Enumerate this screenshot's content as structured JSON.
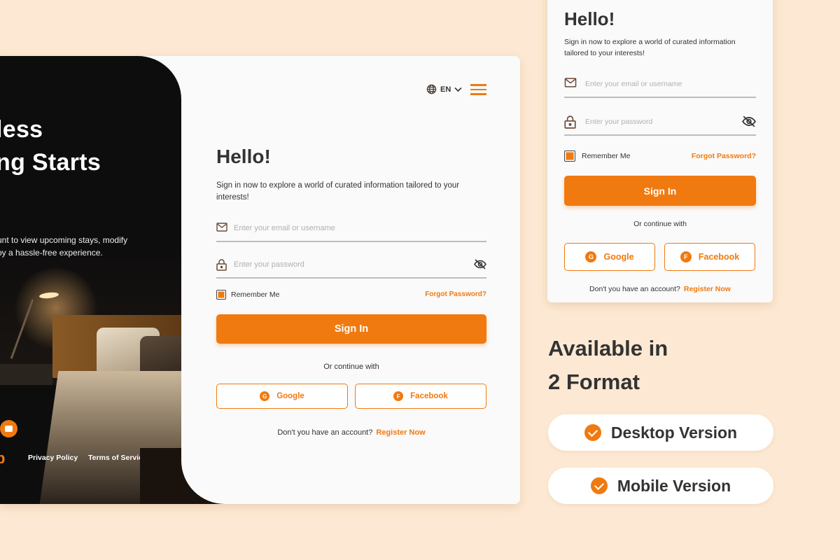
{
  "hero": {
    "title_line1": "less",
    "title_line2": "ng Starts",
    "desc_line1": "unt to view upcoming stays, modify",
    "desc_line2": "oy a hassle-free experience.",
    "logo_fragment": "b",
    "privacy": "Privacy Policy",
    "terms": "Terms of Service"
  },
  "header": {
    "language": "EN"
  },
  "login": {
    "title": "Hello!",
    "subtitle": "Sign in now to explore a world of curated information tailored to your interests!",
    "email_placeholder": "Enter your email or username",
    "password_placeholder": "Enter your password",
    "remember": "Remember Me",
    "remember_checked": true,
    "forgot": "Forgot Password?",
    "signin": "Sign In",
    "or_continue": "Or continue with",
    "google": "Google",
    "google_badge": "G",
    "facebook": "Facebook",
    "facebook_badge": "F",
    "no_account": "Don't you have an account?",
    "register": "Register Now"
  },
  "promo": {
    "line1": "Available in",
    "line2": "2 Format",
    "desktop": "Desktop Version",
    "mobile": "Mobile Version"
  },
  "colors": {
    "accent": "#f07a10",
    "background": "#fde9d3",
    "dark": "#0e0d0d"
  }
}
